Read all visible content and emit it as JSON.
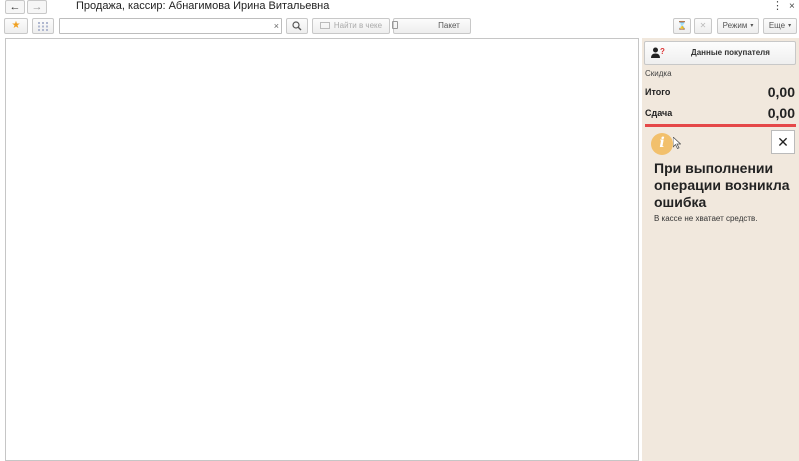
{
  "window": {
    "title": "Продажа, кассир: Абнагимова Ирина Витальевна",
    "back_glyph": "←",
    "forward_glyph": "→",
    "menu_glyph": "⋮",
    "close_glyph": "×"
  },
  "toolbar": {
    "favorite_glyph": "★",
    "search": {
      "value": "",
      "placeholder": "",
      "clear_glyph": "×"
    },
    "search_glyph": "🔍",
    "find_in_receipt_label": "Найти в чеке",
    "package_label": "Пакет",
    "hourglass_glyph": "⌛",
    "cancel_glyph": "✕",
    "mode_label": "Режим",
    "more_label": "Еще",
    "caret_glyph": "▾"
  },
  "side_panel": {
    "buyer_data_label": "Данные покупателя",
    "discount_label": "Скидка",
    "total_label": "Итого",
    "total_value": "0,00",
    "change_label": "Сдача",
    "change_value": "0,00"
  },
  "error": {
    "icon_glyph": "i",
    "close_glyph": "✕",
    "title": "При выполнении операции возникла ошибка",
    "message": "В кассе не хватает средств."
  },
  "colors": {
    "panel_bg": "#f1e8dd",
    "accent_red": "#e54848",
    "info_icon": "#f2c06c",
    "favorite_star": "#f0a020"
  }
}
